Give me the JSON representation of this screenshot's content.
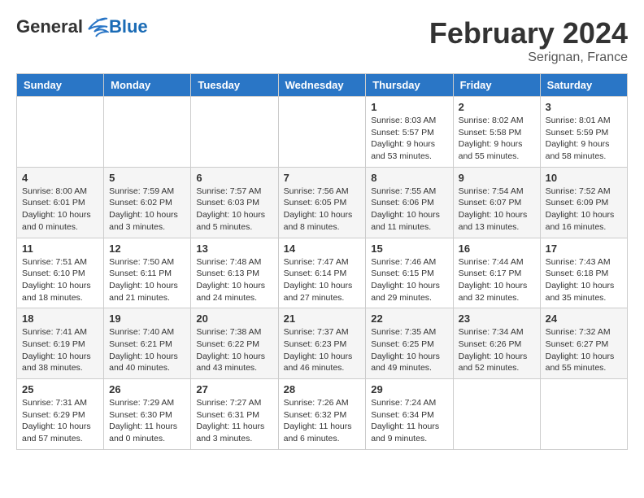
{
  "header": {
    "logo_general": "General",
    "logo_blue": "Blue",
    "month_title": "February 2024",
    "location": "Serignan, France"
  },
  "days_of_week": [
    "Sunday",
    "Monday",
    "Tuesday",
    "Wednesday",
    "Thursday",
    "Friday",
    "Saturday"
  ],
  "weeks": [
    [
      {
        "day": "",
        "info": ""
      },
      {
        "day": "",
        "info": ""
      },
      {
        "day": "",
        "info": ""
      },
      {
        "day": "",
        "info": ""
      },
      {
        "day": "1",
        "info": "Sunrise: 8:03 AM\nSunset: 5:57 PM\nDaylight: 9 hours\nand 53 minutes."
      },
      {
        "day": "2",
        "info": "Sunrise: 8:02 AM\nSunset: 5:58 PM\nDaylight: 9 hours\nand 55 minutes."
      },
      {
        "day": "3",
        "info": "Sunrise: 8:01 AM\nSunset: 5:59 PM\nDaylight: 9 hours\nand 58 minutes."
      }
    ],
    [
      {
        "day": "4",
        "info": "Sunrise: 8:00 AM\nSunset: 6:01 PM\nDaylight: 10 hours\nand 0 minutes."
      },
      {
        "day": "5",
        "info": "Sunrise: 7:59 AM\nSunset: 6:02 PM\nDaylight: 10 hours\nand 3 minutes."
      },
      {
        "day": "6",
        "info": "Sunrise: 7:57 AM\nSunset: 6:03 PM\nDaylight: 10 hours\nand 5 minutes."
      },
      {
        "day": "7",
        "info": "Sunrise: 7:56 AM\nSunset: 6:05 PM\nDaylight: 10 hours\nand 8 minutes."
      },
      {
        "day": "8",
        "info": "Sunrise: 7:55 AM\nSunset: 6:06 PM\nDaylight: 10 hours\nand 11 minutes."
      },
      {
        "day": "9",
        "info": "Sunrise: 7:54 AM\nSunset: 6:07 PM\nDaylight: 10 hours\nand 13 minutes."
      },
      {
        "day": "10",
        "info": "Sunrise: 7:52 AM\nSunset: 6:09 PM\nDaylight: 10 hours\nand 16 minutes."
      }
    ],
    [
      {
        "day": "11",
        "info": "Sunrise: 7:51 AM\nSunset: 6:10 PM\nDaylight: 10 hours\nand 18 minutes."
      },
      {
        "day": "12",
        "info": "Sunrise: 7:50 AM\nSunset: 6:11 PM\nDaylight: 10 hours\nand 21 minutes."
      },
      {
        "day": "13",
        "info": "Sunrise: 7:48 AM\nSunset: 6:13 PM\nDaylight: 10 hours\nand 24 minutes."
      },
      {
        "day": "14",
        "info": "Sunrise: 7:47 AM\nSunset: 6:14 PM\nDaylight: 10 hours\nand 27 minutes."
      },
      {
        "day": "15",
        "info": "Sunrise: 7:46 AM\nSunset: 6:15 PM\nDaylight: 10 hours\nand 29 minutes."
      },
      {
        "day": "16",
        "info": "Sunrise: 7:44 AM\nSunset: 6:17 PM\nDaylight: 10 hours\nand 32 minutes."
      },
      {
        "day": "17",
        "info": "Sunrise: 7:43 AM\nSunset: 6:18 PM\nDaylight: 10 hours\nand 35 minutes."
      }
    ],
    [
      {
        "day": "18",
        "info": "Sunrise: 7:41 AM\nSunset: 6:19 PM\nDaylight: 10 hours\nand 38 minutes."
      },
      {
        "day": "19",
        "info": "Sunrise: 7:40 AM\nSunset: 6:21 PM\nDaylight: 10 hours\nand 40 minutes."
      },
      {
        "day": "20",
        "info": "Sunrise: 7:38 AM\nSunset: 6:22 PM\nDaylight: 10 hours\nand 43 minutes."
      },
      {
        "day": "21",
        "info": "Sunrise: 7:37 AM\nSunset: 6:23 PM\nDaylight: 10 hours\nand 46 minutes."
      },
      {
        "day": "22",
        "info": "Sunrise: 7:35 AM\nSunset: 6:25 PM\nDaylight: 10 hours\nand 49 minutes."
      },
      {
        "day": "23",
        "info": "Sunrise: 7:34 AM\nSunset: 6:26 PM\nDaylight: 10 hours\nand 52 minutes."
      },
      {
        "day": "24",
        "info": "Sunrise: 7:32 AM\nSunset: 6:27 PM\nDaylight: 10 hours\nand 55 minutes."
      }
    ],
    [
      {
        "day": "25",
        "info": "Sunrise: 7:31 AM\nSunset: 6:29 PM\nDaylight: 10 hours\nand 57 minutes."
      },
      {
        "day": "26",
        "info": "Sunrise: 7:29 AM\nSunset: 6:30 PM\nDaylight: 11 hours\nand 0 minutes."
      },
      {
        "day": "27",
        "info": "Sunrise: 7:27 AM\nSunset: 6:31 PM\nDaylight: 11 hours\nand 3 minutes."
      },
      {
        "day": "28",
        "info": "Sunrise: 7:26 AM\nSunset: 6:32 PM\nDaylight: 11 hours\nand 6 minutes."
      },
      {
        "day": "29",
        "info": "Sunrise: 7:24 AM\nSunset: 6:34 PM\nDaylight: 11 hours\nand 9 minutes."
      },
      {
        "day": "",
        "info": ""
      },
      {
        "day": "",
        "info": ""
      }
    ]
  ]
}
